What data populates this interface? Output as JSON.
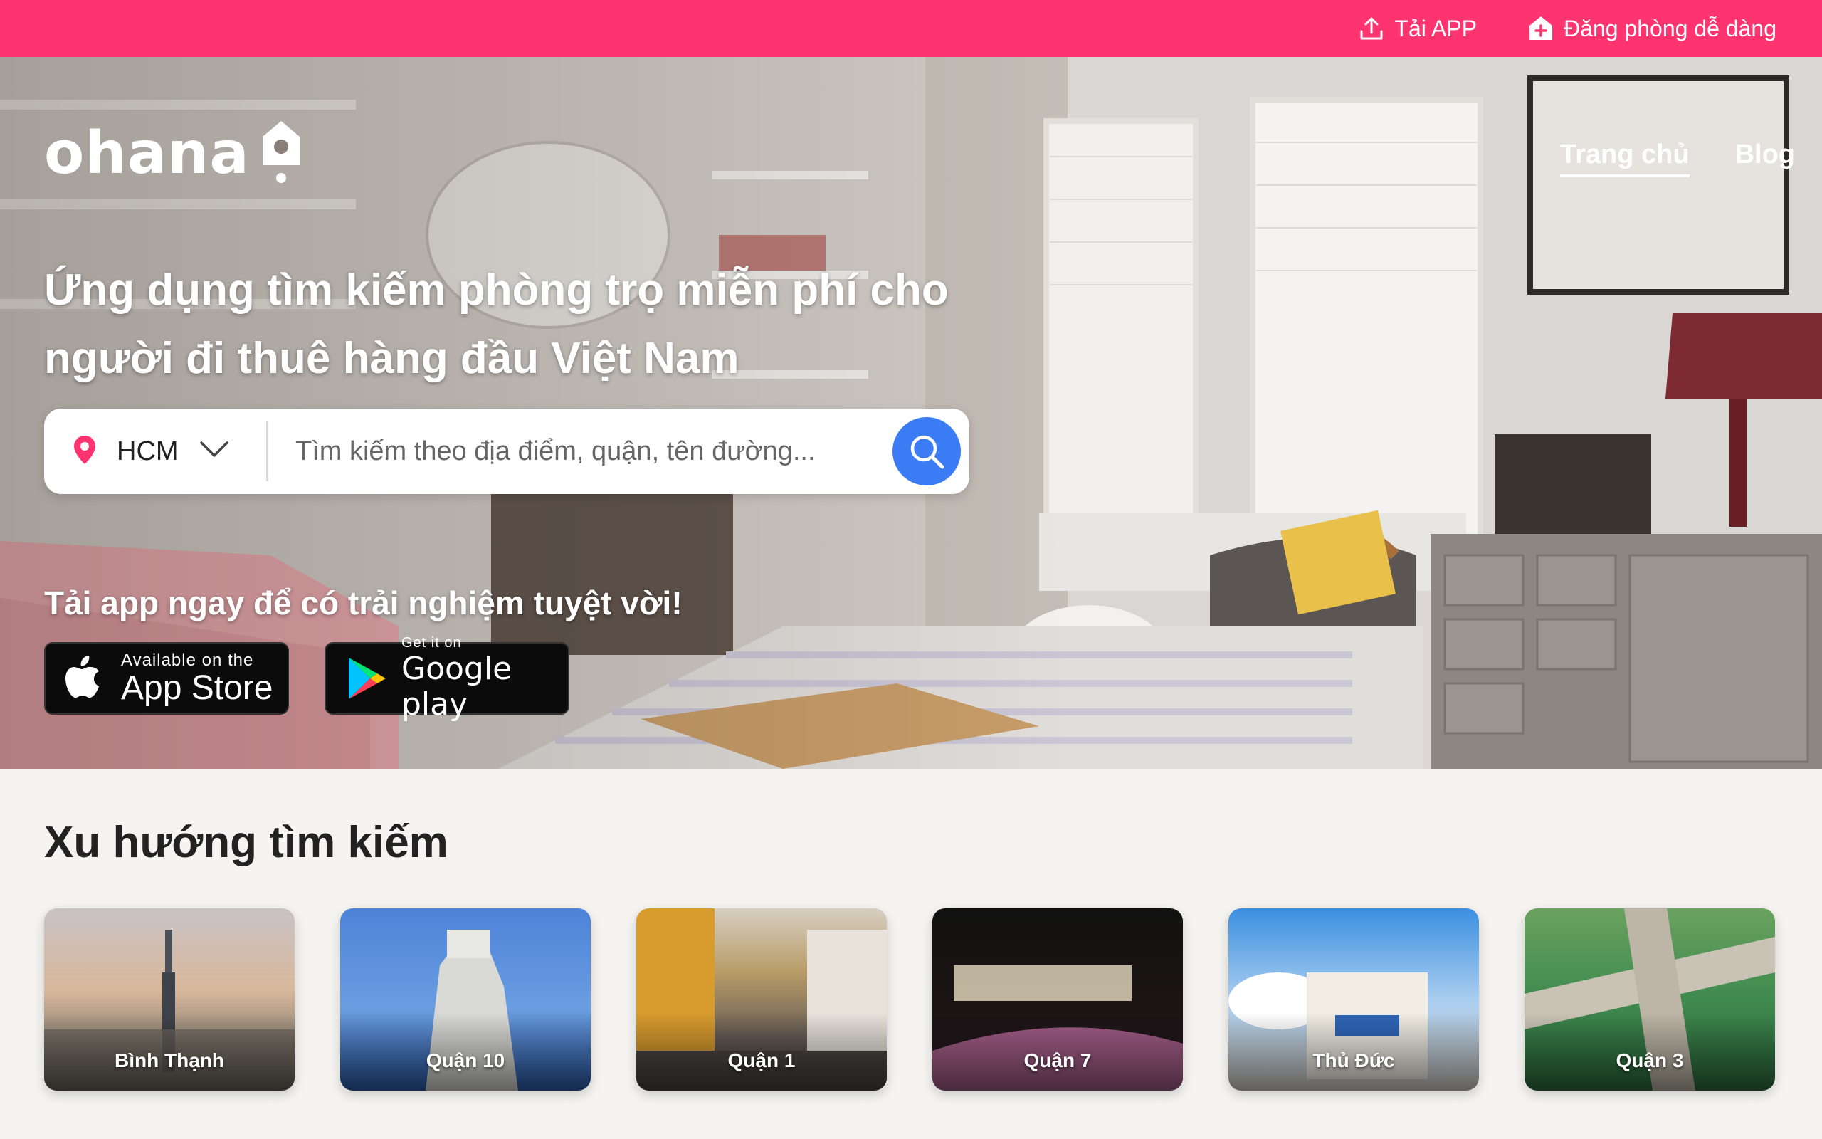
{
  "colors": {
    "brand_pink": "#fe3471",
    "search_blue": "#3b7cf5",
    "page_bg": "#f5f4f1"
  },
  "topbar": {
    "download_app": {
      "label": "Tải APP",
      "icon": "upload-icon"
    },
    "post_room": {
      "label": "Đăng phòng dễ dàng",
      "icon": "house-plus-icon"
    }
  },
  "brand": {
    "logo_text": "ohana"
  },
  "nav": {
    "home": "Trang chủ",
    "blog": "Blog"
  },
  "hero": {
    "headline_line1": "Ứng dụng tìm kiếm phòng trọ miễn phí cho",
    "headline_line2": "người đi thuê hàng đầu Việt Nam",
    "cta": "Tải app ngay để có trải nghiệm tuyệt vời!"
  },
  "search": {
    "city": "HCM",
    "placeholder": "Tìm kiếm theo địa điểm, quận, tên đường..."
  },
  "stores": {
    "apple_small": "Available on the",
    "apple_big": "App Store",
    "google_small": "Get it on",
    "google_big": "Google play"
  },
  "trending": {
    "title": "Xu hướng tìm kiếm",
    "items": [
      {
        "label": "Bình Thạnh"
      },
      {
        "label": "Quận 10"
      },
      {
        "label": "Quận 1"
      },
      {
        "label": "Quận 7"
      },
      {
        "label": "Thủ Đức"
      },
      {
        "label": "Quận 3"
      }
    ]
  }
}
